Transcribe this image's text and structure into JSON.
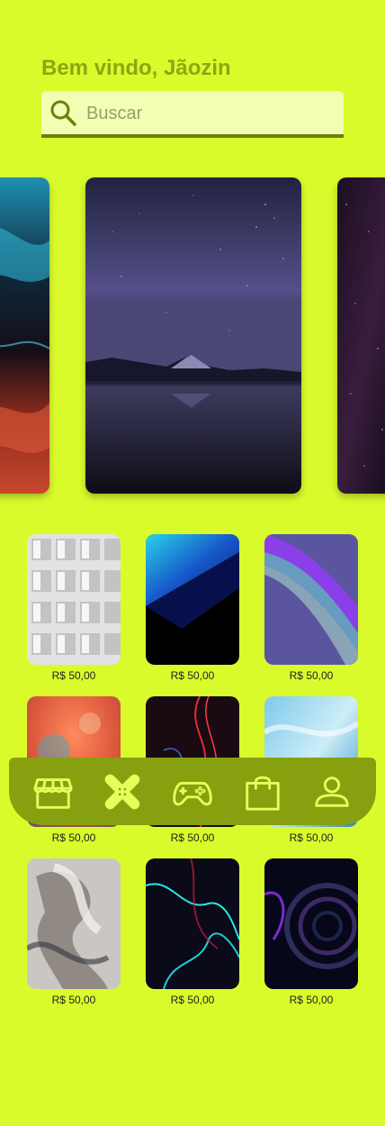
{
  "header": {
    "greeting": "Bem vindo, Jãozin"
  },
  "search": {
    "placeholder": "Buscar"
  },
  "carousel": [
    {
      "name": "abstract-fluid-blue-red"
    },
    {
      "name": "night-sky-mountain-lake"
    },
    {
      "name": "purple-starfield"
    }
  ],
  "grid": [
    {
      "price": "R$ 50,00",
      "theme": "white-3d-squares"
    },
    {
      "price": "R$ 50,00",
      "theme": "blue-gradient-diagonal"
    },
    {
      "price": "R$ 50,00",
      "theme": "purple-waves"
    },
    {
      "price": "R$ 50,00",
      "theme": "orange-clouds"
    },
    {
      "price": "R$ 50,00",
      "theme": "red-light-trails"
    },
    {
      "price": "R$ 50,00",
      "theme": "blue-marble"
    },
    {
      "price": "R$ 50,00",
      "theme": "white-fluid-swirl"
    },
    {
      "price": "R$ 50,00",
      "theme": "neon-cyan-fluid"
    },
    {
      "price": "R$ 50,00",
      "theme": "dark-swirl-vortex"
    }
  ],
  "navbar": {
    "items": [
      {
        "icon": "store-icon"
      },
      {
        "icon": "bandage-icon"
      },
      {
        "icon": "gamepad-icon"
      },
      {
        "icon": "shopping-bag-icon"
      },
      {
        "icon": "user-icon"
      }
    ]
  },
  "colors": {
    "background": "#dafb2b",
    "accent": "#8ea613",
    "navbar": "#87a010",
    "nav_icon": "#e7ff5a",
    "search_bg": "#f1ffb5"
  }
}
